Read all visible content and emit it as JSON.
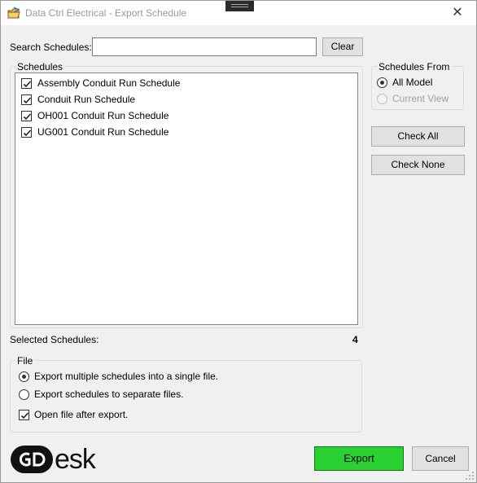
{
  "window": {
    "title": "Data Ctrl Electrical - Export Schedule",
    "title_icon": "folder-export-icon",
    "close_glyph": "✕"
  },
  "search": {
    "label": "Search Schedules:",
    "value": "",
    "placeholder": "",
    "clear_label": "Clear"
  },
  "schedules": {
    "legend": "Schedules",
    "items": [
      {
        "label": "Assembly Conduit Run Schedule",
        "checked": true
      },
      {
        "label": "Conduit Run Schedule",
        "checked": true
      },
      {
        "label": "OH001 Conduit Run Schedule",
        "checked": true
      },
      {
        "label": "UG001 Conduit Run Schedule",
        "checked": true
      }
    ]
  },
  "schedules_from": {
    "legend": "Schedules From",
    "options": [
      {
        "label": "All Model",
        "selected": true,
        "enabled": true
      },
      {
        "label": "Current View",
        "selected": false,
        "enabled": false
      }
    ]
  },
  "actions": {
    "check_all_label": "Check All",
    "check_none_label": "Check None"
  },
  "selected": {
    "label": "Selected Schedules:",
    "count": "4"
  },
  "file": {
    "legend": "File",
    "options": [
      {
        "label": "Export multiple schedules into a single file.",
        "selected": true
      },
      {
        "label": "Export schedules to separate files.",
        "selected": false
      }
    ],
    "open_after": {
      "label": "Open file after export.",
      "checked": true
    }
  },
  "brand": {
    "logo_text": "esk"
  },
  "footer": {
    "export_label": "Export",
    "cancel_label": "Cancel"
  },
  "colors": {
    "export_button": "#2bd132",
    "window_bg": "#f0f0f0"
  }
}
